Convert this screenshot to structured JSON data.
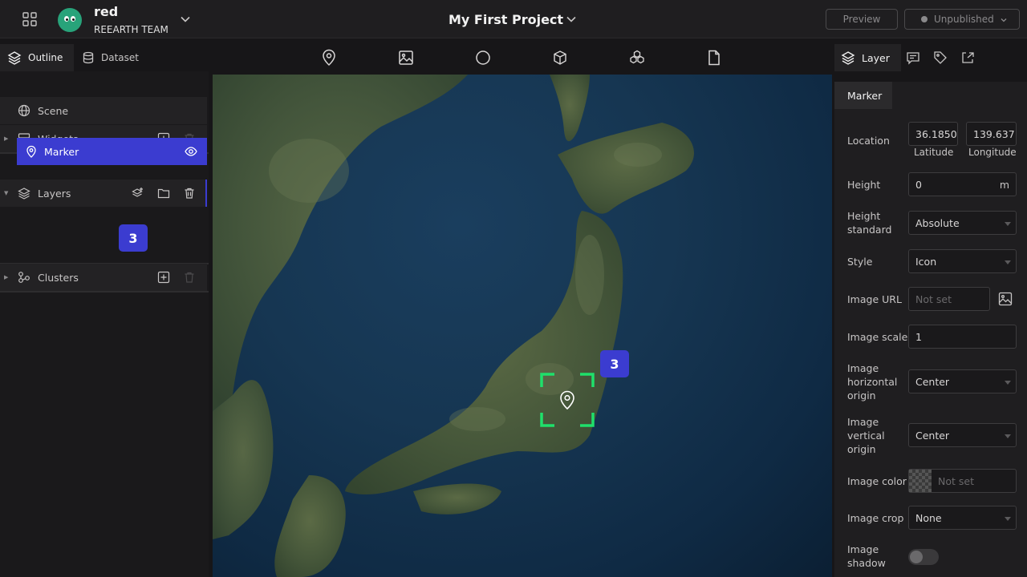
{
  "header": {
    "user_name": "red",
    "team_name": "REEARTH TEAM",
    "project_title": "My First Project",
    "preview_label": "Preview",
    "publish_status": "Unpublished"
  },
  "left_panel": {
    "tabs": [
      {
        "label": "Outline",
        "icon": "layers-icon",
        "active": true
      },
      {
        "label": "Dataset",
        "icon": "database-icon",
        "active": false
      }
    ],
    "tree": {
      "scene": "Scene",
      "widgets": "Widgets",
      "layers": "Layers",
      "marker": "Marker",
      "clusters": "Clusters"
    },
    "badge": "3"
  },
  "toolbar": {
    "tools": [
      "marker-tool-icon",
      "image-tool-icon",
      "sphere-tool-icon",
      "box-tool-icon",
      "model-tool-icon",
      "file-tool-icon"
    ]
  },
  "map": {
    "badge": "3"
  },
  "right_panel": {
    "tabs": [
      {
        "label": "Layer",
        "icon": "layers-icon",
        "active": true
      },
      {
        "label": "",
        "icon": "info-icon",
        "active": false
      },
      {
        "label": "",
        "icon": "tag-icon",
        "active": false
      },
      {
        "label": "",
        "icon": "export-icon",
        "active": false
      }
    ],
    "section_tab": "Marker",
    "properties": {
      "location": {
        "label": "Location",
        "latitude_value": "36.1850",
        "latitude_label": "Latitude",
        "longitude_value": "139.637",
        "longitude_label": "Longitude"
      },
      "height": {
        "label": "Height",
        "value": "0",
        "unit": "m"
      },
      "height_standard": {
        "label": "Height standard",
        "value": "Absolute"
      },
      "style": {
        "label": "Style",
        "value": "Icon"
      },
      "image_url": {
        "label": "Image URL",
        "placeholder": "Not set"
      },
      "image_scale": {
        "label": "Image scale",
        "value": "1"
      },
      "image_h_origin": {
        "label": "Image horizontal origin",
        "value": "Center"
      },
      "image_v_origin": {
        "label": "Image vertical origin",
        "value": "Center"
      },
      "image_color": {
        "label": "Image color",
        "placeholder": "Not set"
      },
      "image_crop": {
        "label": "Image crop",
        "value": "None"
      },
      "image_shadow": {
        "label": "Image shadow",
        "enabled": false
      }
    }
  },
  "colors": {
    "accent": "#3b3cd0",
    "selection": "#1fe06b",
    "background": "#171618"
  }
}
